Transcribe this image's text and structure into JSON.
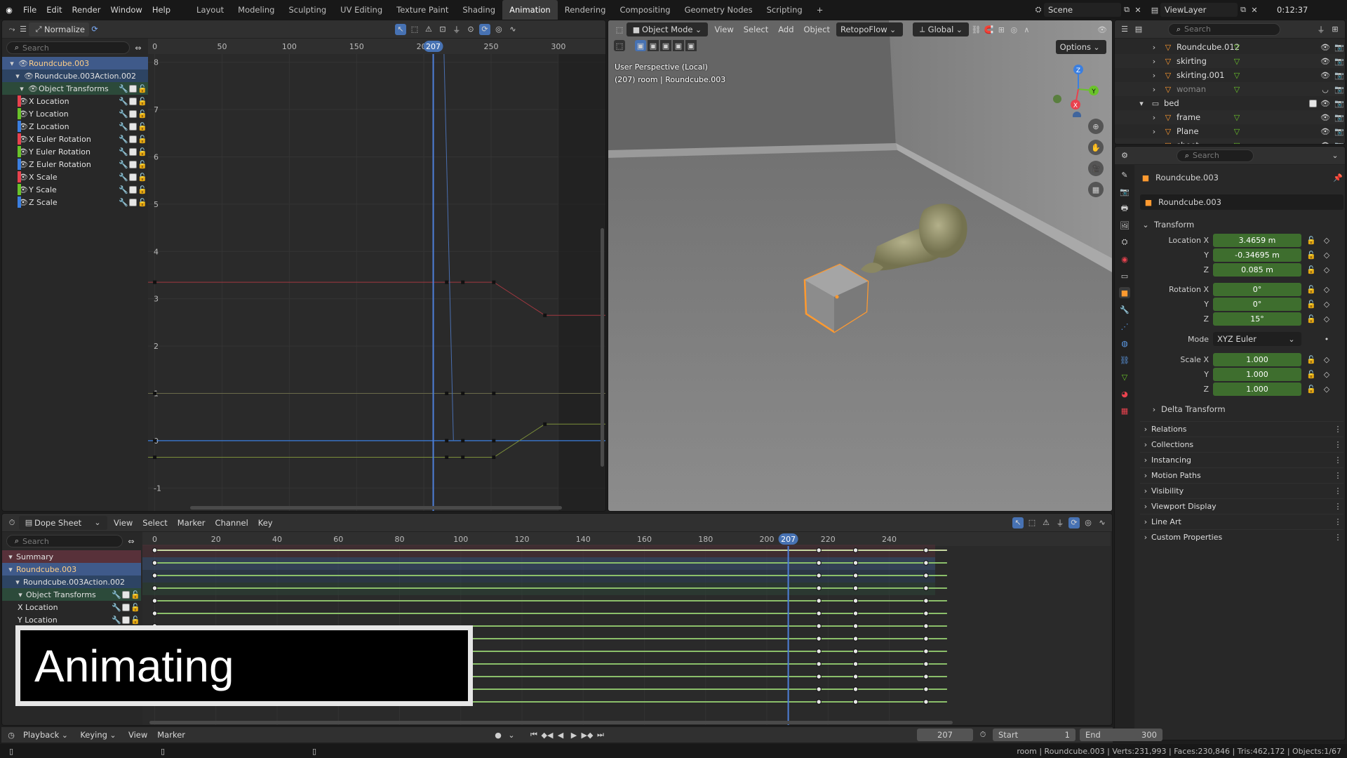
{
  "topbar": {
    "menus": [
      "File",
      "Edit",
      "Render",
      "Window",
      "Help"
    ],
    "tabs": [
      "Layout",
      "Modeling",
      "Sculpting",
      "UV Editing",
      "Texture Paint",
      "Shading",
      "Animation",
      "Rendering",
      "Compositing",
      "Geometry Nodes",
      "Scripting"
    ],
    "active_tab": "Animation",
    "add_tab": "+",
    "scene": "Scene",
    "viewlayer": "ViewLayer",
    "time": "0:12:37"
  },
  "graph": {
    "normalize": "Normalize",
    "search_placeholder": "Search",
    "ticks": [
      "0",
      "50",
      "100",
      "150",
      "200",
      "250",
      "300"
    ],
    "current_frame": "207",
    "yticks": [
      "8",
      "7",
      "6",
      "5",
      "4",
      "3",
      "2",
      "1",
      "0",
      "-1"
    ],
    "channels": [
      {
        "label": "Roundcube.003",
        "kind": "object"
      },
      {
        "label": "Roundcube.003Action.002",
        "kind": "action"
      },
      {
        "label": "Object Transforms",
        "kind": "group"
      },
      {
        "label": "X Location",
        "color": "#e8424e"
      },
      {
        "label": "Y Location",
        "color": "#6ac32a"
      },
      {
        "label": "Z Location",
        "color": "#3b7fe0"
      },
      {
        "label": "X Euler Rotation",
        "color": "#e8424e"
      },
      {
        "label": "Y Euler Rotation",
        "color": "#6ac32a"
      },
      {
        "label": "Z Euler Rotation",
        "color": "#3b7fe0"
      },
      {
        "label": "X Scale",
        "color": "#e8424e"
      },
      {
        "label": "Y Scale",
        "color": "#6ac32a"
      },
      {
        "label": "Z Scale",
        "color": "#3b7fe0"
      }
    ]
  },
  "viewport": {
    "mode": "Object Mode",
    "menus": [
      "View",
      "Select",
      "Add",
      "Object"
    ],
    "retopo": "RetopoFlow",
    "orientation": "Global",
    "options": "Options",
    "info1": "User Perspective (Local)",
    "info2": "(207) room | Roundcube.003",
    "gizmo": {
      "x": "X",
      "y": "Y",
      "z": "Z"
    }
  },
  "outliner": {
    "search_placeholder": "Search",
    "items": [
      {
        "label": "Roundcube.012",
        "indent": 1
      },
      {
        "label": "skirting",
        "indent": 1
      },
      {
        "label": "skirting.001",
        "indent": 1
      },
      {
        "label": "woman",
        "indent": 1,
        "dim": true
      },
      {
        "label": "bed",
        "indent": 0,
        "collection": true
      },
      {
        "label": "frame",
        "indent": 1
      },
      {
        "label": "Plane",
        "indent": 1
      },
      {
        "label": "sheet",
        "indent": 1
      }
    ]
  },
  "properties": {
    "search_placeholder": "Search",
    "object_name": "Roundcube.003",
    "datablock": "Roundcube.003",
    "transform": "Transform",
    "location": {
      "label": "Location X",
      "x": "3.4659 m",
      "y": "-0.34695 m",
      "z": "0.085 m"
    },
    "rotation": {
      "label": "Rotation X",
      "x": "0°",
      "y": "0°",
      "z": "15°"
    },
    "mode_label": "Mode",
    "mode": "XYZ Euler",
    "scale": {
      "label": "Scale X",
      "x": "1.000",
      "y": "1.000",
      "z": "1.000"
    },
    "axis_y": "Y",
    "axis_z": "Z",
    "delta": "Delta Transform",
    "sections": [
      "Relations",
      "Collections",
      "Instancing",
      "Motion Paths",
      "Visibility",
      "Viewport Display",
      "Line Art",
      "Custom Properties"
    ]
  },
  "dopesheet": {
    "mode": "Dope Sheet",
    "menus": [
      "View",
      "Select",
      "Marker",
      "Channel",
      "Key"
    ],
    "search_placeholder": "Search",
    "ticks": [
      "0",
      "20",
      "40",
      "60",
      "80",
      "100",
      "120",
      "140",
      "160",
      "180",
      "200",
      "220",
      "240"
    ],
    "current_frame": "207",
    "rows": [
      {
        "label": "Summary",
        "kind": "summary"
      },
      {
        "label": "Roundcube.003",
        "kind": "object"
      },
      {
        "label": "Roundcube.003Action.002",
        "kind": "action"
      },
      {
        "label": "Object Transforms",
        "kind": "group"
      },
      {
        "label": "X Location",
        "kind": "chan"
      },
      {
        "label": "Y Location",
        "kind": "chan"
      }
    ],
    "key_frames": [
      0,
      217,
      229,
      252
    ],
    "row_count": 13
  },
  "overlay": {
    "text": "Animating"
  },
  "timeline": {
    "menus": [
      "Playback",
      "Keying",
      "View",
      "Marker"
    ],
    "frame": "207",
    "start_label": "Start",
    "start": "1",
    "end_label": "End",
    "end": "300"
  },
  "status": {
    "text": "room | Roundcube.003 | Verts:231,993 | Faces:230,846 | Tris:462,172 | Objects:1/67"
  }
}
